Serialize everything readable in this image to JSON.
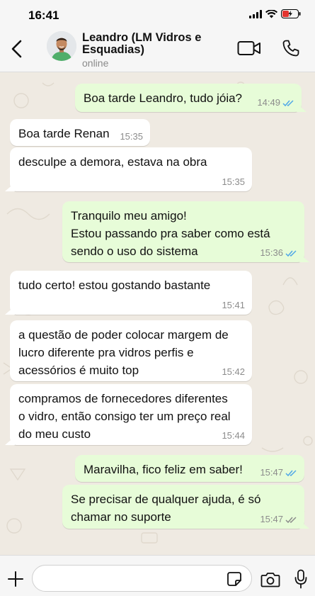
{
  "status_bar": {
    "time": "16:41"
  },
  "header": {
    "contact_name": "Leandro (LM Vidros e Esquadias)",
    "contact_status": "online"
  },
  "messages": [
    {
      "direction": "out",
      "text": "Boa tarde Leandro, tudo jóia?",
      "time": "14:49",
      "ticks": "read"
    },
    {
      "direction": "in",
      "text": "Boa tarde Renan",
      "time": "15:35"
    },
    {
      "direction": "in",
      "text": "desculpe a demora, estava na obra",
      "time": "15:35"
    },
    {
      "direction": "out",
      "text": "Tranquilo meu amigo!\nEstou passando pra saber como está\nsendo o uso do sistema",
      "time": "15:36",
      "ticks": "read"
    },
    {
      "direction": "in",
      "text": "tudo certo! estou gostando bastante",
      "time": "15:41"
    },
    {
      "direction": "in",
      "text": "a questão de poder colocar margem de\nlucro diferente pra vidros perfis e\nacessórios é muito top",
      "time": "15:42"
    },
    {
      "direction": "in",
      "text": "compramos de fornecedores diferentes\no vidro, então consigo ter um preço real\ndo meu custo",
      "time": "15:44"
    },
    {
      "direction": "out",
      "text": "Maravilha, fico feliz em saber!",
      "time": "15:47",
      "ticks": "read"
    },
    {
      "direction": "out",
      "text": "Se precisar de qualquer ajuda, é só\nchamar no suporte",
      "time": "15:47",
      "ticks": "delivered"
    }
  ],
  "composer": {
    "input_value": ""
  },
  "colors": {
    "incoming_bubble": "#ffffff",
    "outgoing_bubble": "#e7fcd8",
    "read_tick": "#4fa7e8",
    "delivered_tick": "#8c8c8c",
    "chat_background": "#efeae2"
  },
  "icons": {
    "back": "chevron-left-icon",
    "video": "video-camera-icon",
    "call": "phone-icon",
    "plus": "plus-icon",
    "sticker": "sticker-icon",
    "camera": "camera-icon",
    "mic": "microphone-icon"
  }
}
